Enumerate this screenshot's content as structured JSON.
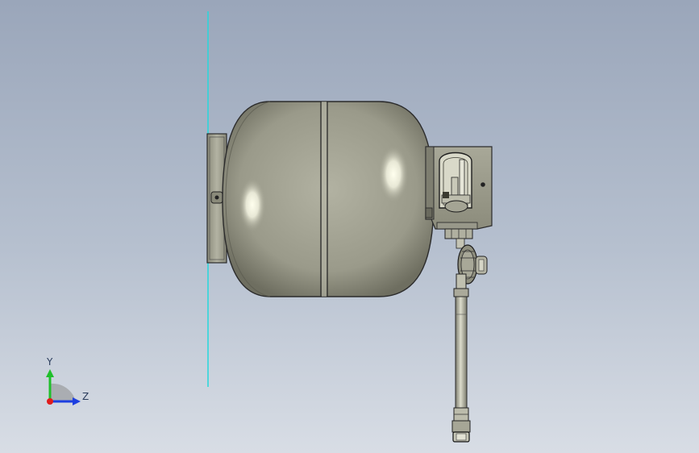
{
  "viewport": {
    "background_top": "#9aa6ba",
    "background_bottom": "#d8dde5"
  },
  "model": {
    "description_icon": "gas-cylinder-with-regulator",
    "body_color": "#9a9a8a",
    "highlight_color": "#fffff2",
    "edge_color": "#2b2b2b"
  },
  "reference_plane": {
    "color": "#25d8dc"
  },
  "triad": {
    "y_label": "Y",
    "z_label": "Z",
    "y_color": "#1fbf2a",
    "z_color": "#1d3fe0",
    "x_color": "#e01c1c"
  }
}
